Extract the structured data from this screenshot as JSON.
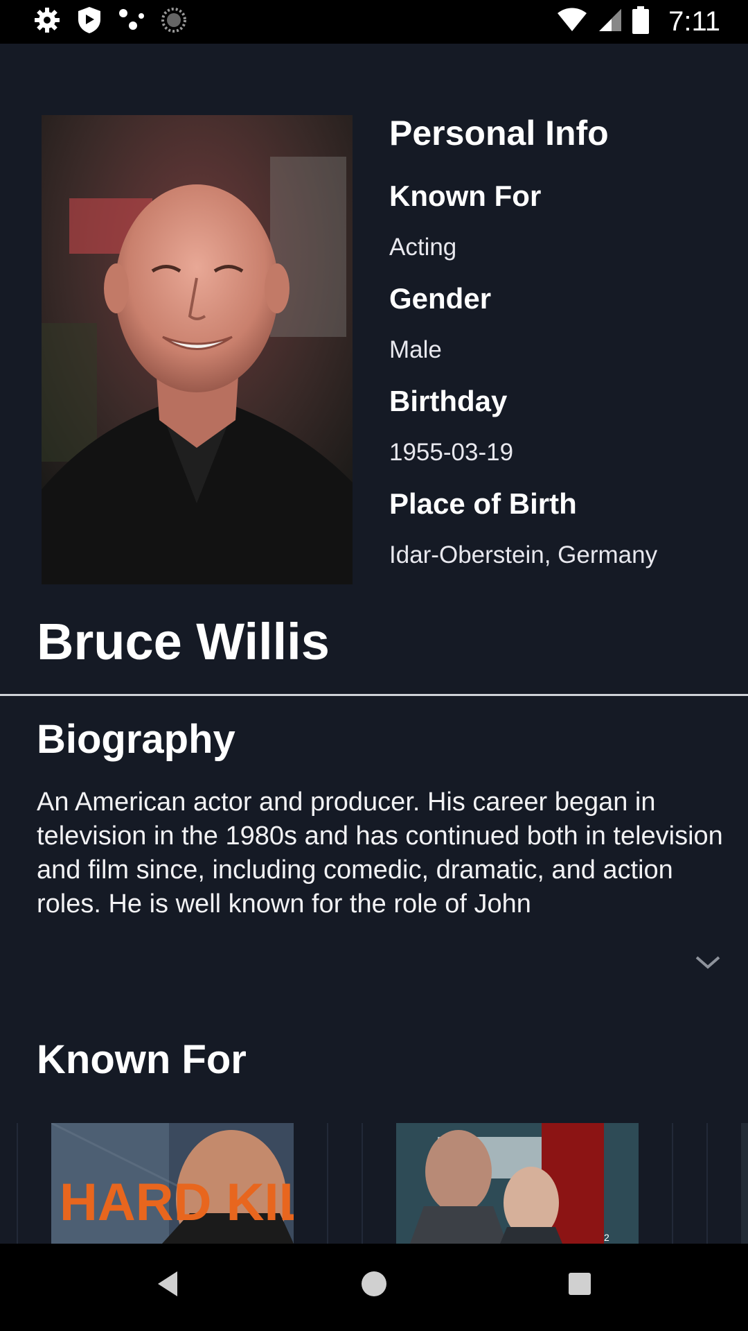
{
  "status_bar": {
    "time": "7:11",
    "left_icons": [
      "settings-icon",
      "shield-play-icon",
      "dots-icon",
      "spinner-icon"
    ],
    "right_icons": [
      "wifi-icon",
      "signal-icon",
      "battery-icon"
    ]
  },
  "person": {
    "name": "Bruce Willis",
    "photo_alt": "Bruce Willis"
  },
  "personal_info": {
    "title": "Personal Info",
    "known_for_label": "Known For",
    "known_for_value": "Acting",
    "gender_label": "Gender",
    "gender_value": "Male",
    "birthday_label": "Birthday",
    "birthday_value": "1955-03-19",
    "place_label": "Place of Birth",
    "place_value": "Idar-Oberstein, Germany"
  },
  "biography": {
    "title": "Biography",
    "text": "An American actor and producer. His career began in television in the 1980s and has continued both in television and film since, including comedic, dramatic, and action roles. He is well known for the role of John"
  },
  "known_for": {
    "title": "Known For",
    "posters": [
      {
        "title_text": "HARD KILL"
      },
      {
        "title_text": "2"
      }
    ]
  },
  "colors": {
    "background": "#151a25",
    "status_bar": "#000000",
    "divider": "#cfd2d8",
    "accent_orange": "#e8661e"
  }
}
